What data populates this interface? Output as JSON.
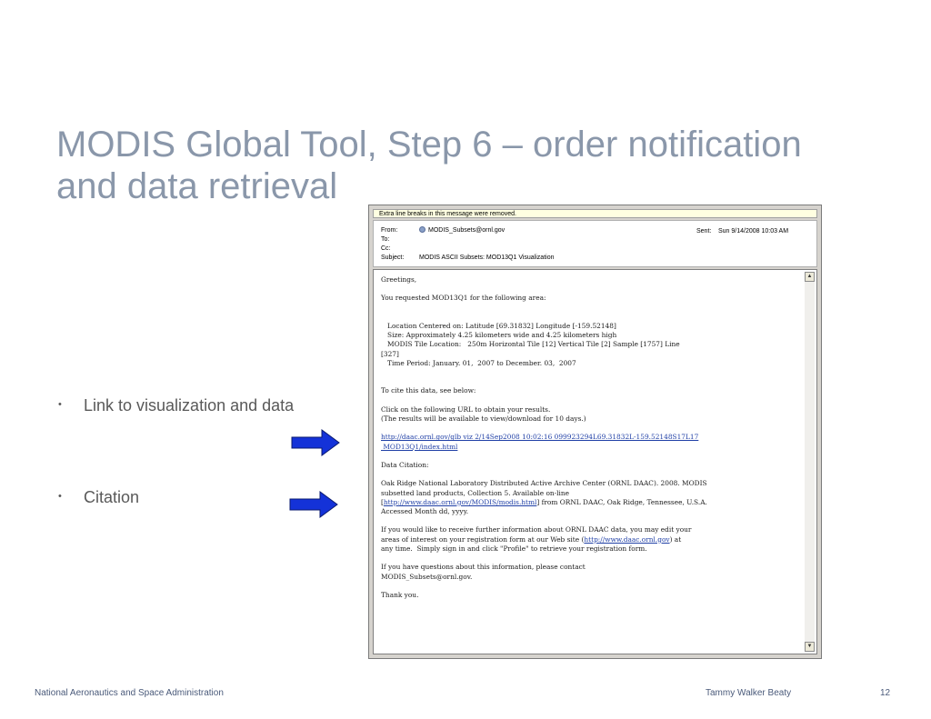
{
  "slide": {
    "title_line1": "MODIS Global Tool, Step 6 – order notification",
    "title_line2": "and data retrieval",
    "bullets": [
      {
        "label": "Link to visualization and data"
      },
      {
        "label": "Citation"
      }
    ],
    "bullet_symbol": "•",
    "arrow_color": "#1432d8",
    "title_color": "#8a97aa"
  },
  "email": {
    "info_bar": "Extra line breaks in this message were removed.",
    "from_label": "From:",
    "from_value": "MODIS_Subsets@ornl.gov",
    "to_label": "To:",
    "cc_label": "Cc:",
    "subject_label": "Subject:",
    "subject_value": "MODIS ASCII Subsets: MOD13Q1 Visualization",
    "sent_label": "Sent:",
    "sent_value": "Sun 9/14/2008 10:03 AM",
    "scroll_up": "▲",
    "scroll_down": "▼",
    "body": {
      "greeting": "Greetings,",
      "request": "You requested MOD13Q1 for the following area:",
      "loc_line": "   Location Centered on: Latitude [69.31832] Longitude [-159.52148]",
      "size_line": "   Size: Approximately 4.25 kilometers wide and 4.25 kilometers high",
      "tile_line": "   MODIS Tile Location:   250m Horizontal Tile [12] Vertical Tile [2] Sample [1757] Line",
      "tile_line2": "[327]",
      "time_line": "   Time Period: January. 01,  2007 to December. 03,  2007",
      "cite_intro": "To cite this data, see below:",
      "click_line": "Click on the following URL to obtain your results.",
      "available_line": "(The results will be available to view/download for 10 days.)",
      "url_line1": "http://daac.ornl.gov/glb viz 2/14Sep2008 10:02:16 099923294L69.31832L-159.52148S17L17",
      "url_line2": " MOD13Q1/index.html",
      "citation_label": "Data Citation:",
      "cite_line1": "Oak Ridge National Laboratory Distributed Active Archive Center (ORNL DAAC). 2008. MODIS",
      "cite_line2": "subsetted land products, Collection 5. Available on-line",
      "cite_line3_pre": "[",
      "cite_link": "http://www.daac.ornl.gov/MODIS/modis.html",
      "cite_line3_post": "] from ORNL DAAC, Oak Ridge, Tennessee, U.S.A.",
      "cite_line4": "Accessed Month dd, yyyy.",
      "info_line1": "If you would like to receive further information about ORNL DAAC data, you may edit your",
      "info_line2_pre": "areas of interest on your registration form at our Web site (",
      "info_link": "http://www.daac.ornl.gov",
      "info_line2_post": ") at",
      "info_line3": "any time.  Simply sign in and click \"Profile\" to retrieve your registration form.",
      "questions_line1": "If you have questions about this information, please contact",
      "questions_line2": "MODIS_Subsets@ornl.gov.",
      "thanks": "Thank you."
    }
  },
  "footer": {
    "left": "National Aeronautics and Space Administration",
    "center": "Tammy Walker Beaty",
    "page": "12"
  }
}
